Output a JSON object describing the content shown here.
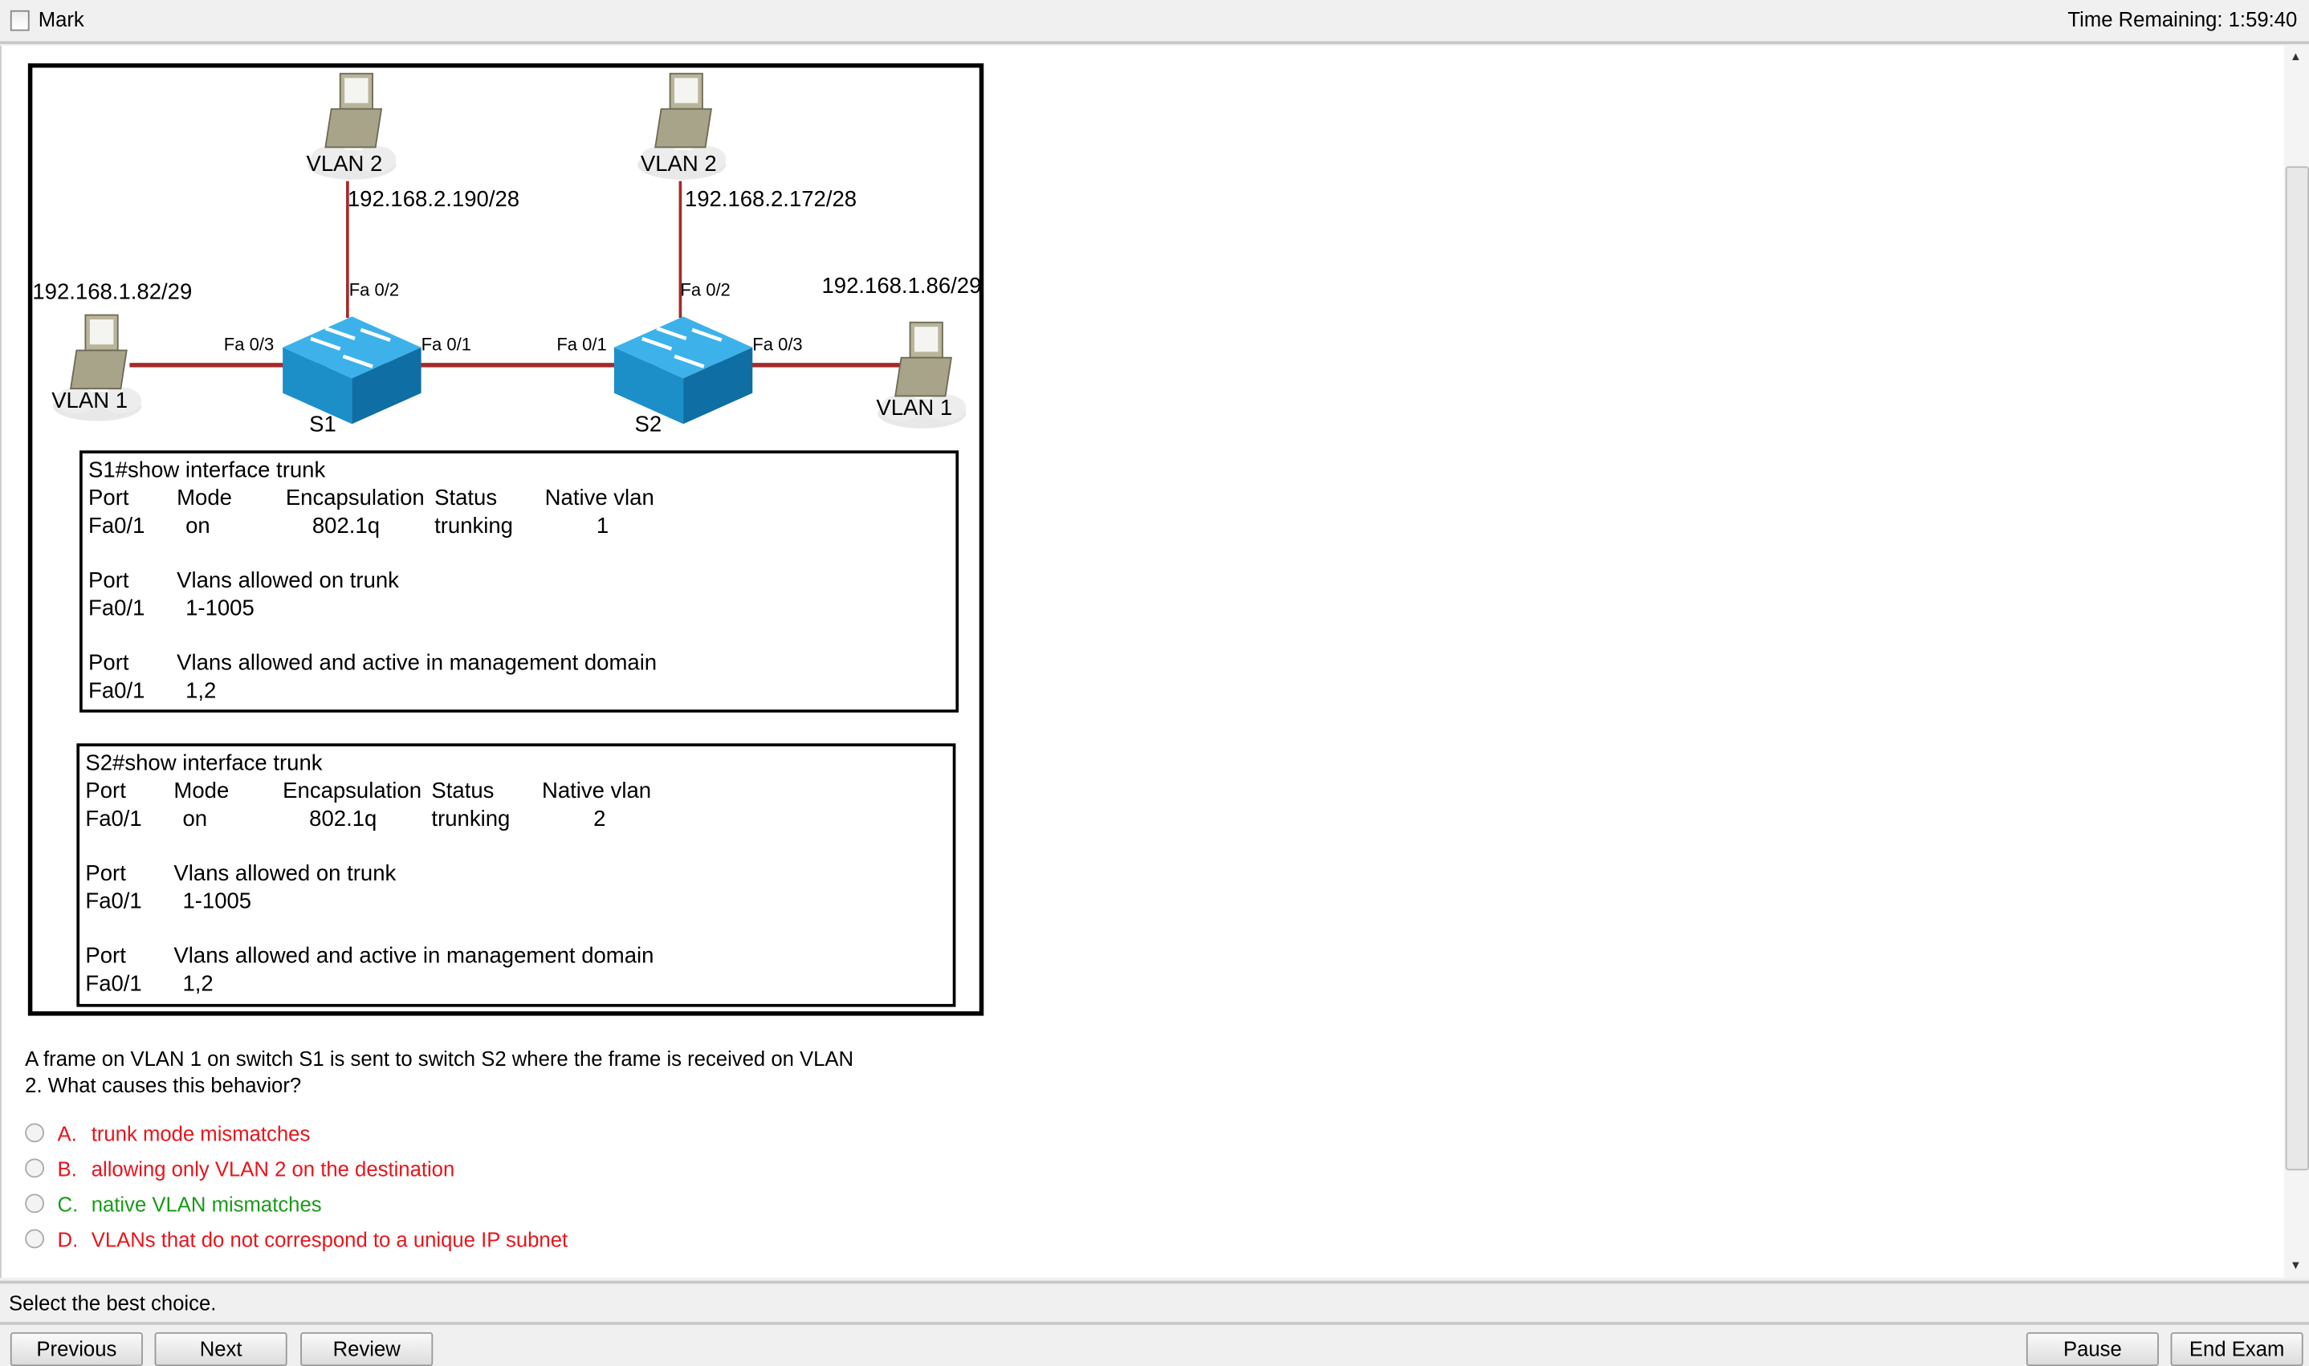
{
  "topbar": {
    "mark_label": "Mark",
    "time_remaining": "Time Remaining: 1:59:40"
  },
  "diagram": {
    "switches": [
      "S1",
      "S2"
    ],
    "hosts": {
      "s1_top": {
        "vlan": "VLAN 2",
        "ip": "192.168.2.190/28"
      },
      "s2_top": {
        "vlan": "VLAN 2",
        "ip": "192.168.2.172/28"
      },
      "s1_left": {
        "vlan": "VLAN 1",
        "ip": "192.168.1.82/29"
      },
      "s2_right": {
        "vlan": "VLAN 1",
        "ip": "192.168.1.86/29"
      }
    },
    "ports": {
      "s1_fa02": "Fa 0/2",
      "s1_fa03": "Fa 0/3",
      "s1_fa01": "Fa 0/1",
      "s2_fa01": "Fa 0/1",
      "s2_fa02": "Fa 0/2",
      "s2_fa03": "Fa 0/3"
    },
    "colors": {
      "switch": "#1e9fd8",
      "link": "#a52a2a"
    },
    "outputs": [
      {
        "command": "S1#show interface trunk",
        "headers": [
          "Port",
          "Mode",
          "Encapsulation",
          "Status",
          "Native vlan"
        ],
        "row": [
          "Fa0/1",
          "on",
          "802.1q",
          "trunking",
          "1"
        ],
        "allowed_header": [
          "Port",
          "Vlans allowed on trunk"
        ],
        "allowed_row": [
          "Fa0/1",
          "1-1005"
        ],
        "active_header": [
          "Port",
          "Vlans allowed and active in management domain"
        ],
        "active_row": [
          "Fa0/1",
          "1,2"
        ]
      },
      {
        "command": "S2#show interface trunk",
        "headers": [
          "Port",
          "Mode",
          "Encapsulation",
          "Status",
          "Native vlan"
        ],
        "row": [
          "Fa0/1",
          "on",
          "802.1q",
          "trunking",
          "2"
        ],
        "allowed_header": [
          "Port",
          "Vlans allowed on trunk"
        ],
        "allowed_row": [
          "Fa0/1",
          "1-1005"
        ],
        "active_header": [
          "Port",
          "Vlans allowed and active in management domain"
        ],
        "active_row": [
          "Fa0/1",
          "1,2"
        ]
      }
    ]
  },
  "question": {
    "line1": "A frame on VLAN 1 on switch S1 is sent to switch S2 where the frame is received on VLAN",
    "line2": "2. What causes this behavior?"
  },
  "options": [
    {
      "letter": "A.",
      "text": "trunk mode mismatches",
      "color": "#e8141b"
    },
    {
      "letter": "B.",
      "text": "allowing only VLAN 2 on the destination",
      "color": "#e8141b"
    },
    {
      "letter": "C.",
      "text": "native VLAN mismatches",
      "color": "#1a9a1a"
    },
    {
      "letter": "D.",
      "text": "VLANs that do not correspond to a unique IP subnet",
      "color": "#e8141b"
    }
  ],
  "footer": {
    "hint": "Select the best choice.",
    "previous": "Previous",
    "next": "Next",
    "review": "Review",
    "pause": "Pause",
    "end_exam": "End Exam"
  }
}
